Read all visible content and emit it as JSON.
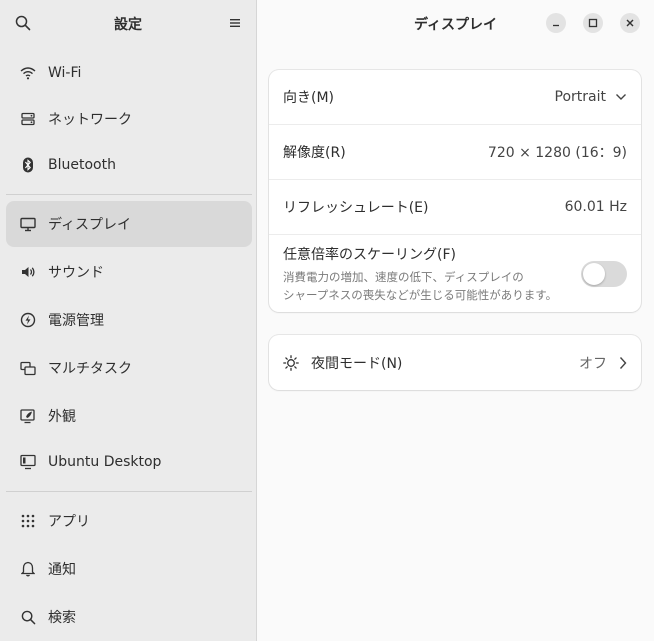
{
  "sidebar": {
    "title": "設定",
    "items": [
      {
        "label": "Wi-Fi",
        "icon": "wifi-icon"
      },
      {
        "label": "ネットワーク",
        "icon": "network-icon"
      },
      {
        "label": "Bluetooth",
        "icon": "bluetooth-icon"
      },
      {
        "label": "ディスプレイ",
        "icon": "display-icon",
        "selected": true
      },
      {
        "label": "サウンド",
        "icon": "sound-icon"
      },
      {
        "label": "電源管理",
        "icon": "power-icon"
      },
      {
        "label": "マルチタスク",
        "icon": "multitasking-icon"
      },
      {
        "label": "外観",
        "icon": "appearance-icon"
      },
      {
        "label": "Ubuntu Desktop",
        "icon": "ubuntu-desktop-icon"
      },
      {
        "label": "アプリ",
        "icon": "apps-icon"
      },
      {
        "label": "通知",
        "icon": "bell-icon"
      },
      {
        "label": "検索",
        "icon": "search-icon"
      }
    ]
  },
  "main": {
    "title": "ディスプレイ",
    "orientation": {
      "label": "向き(M)",
      "value": "Portrait"
    },
    "resolution": {
      "label": "解像度(R)",
      "value": "720 × 1280 (16：9)"
    },
    "refresh": {
      "label": "リフレッシュレート(E)",
      "value": "60.01 Hz"
    },
    "scaling": {
      "label": "任意倍率のスケーリング(F)",
      "desc_line1": "消費電力の増加、速度の低下、ディスプレイの",
      "desc_line2": "シャープネスの喪失などが生じる可能性があります。",
      "enabled": false
    },
    "night": {
      "label": "夜間モード(N)",
      "value": "オフ"
    }
  },
  "colors": {
    "selected_bg": "#d9d9d9",
    "sidebar_bg": "#ebebeb",
    "card_bg": "#ffffff"
  }
}
